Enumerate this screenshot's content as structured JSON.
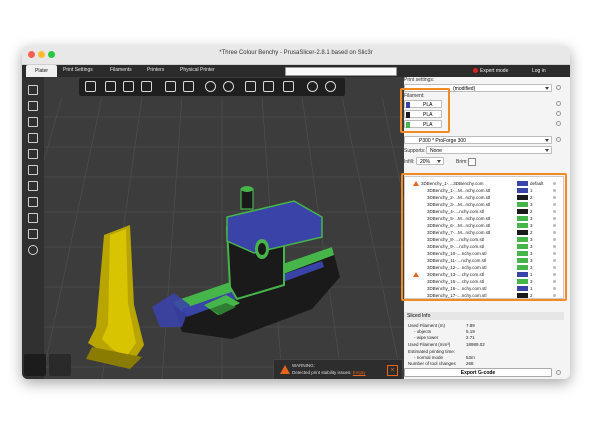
{
  "window": {
    "title": "*Three Colour Benchy - PrusaSlicer-2.8.1 based on Slic3r"
  },
  "tabs": [
    {
      "label": "Plater"
    },
    {
      "label": "Print Settings"
    },
    {
      "label": "Filaments"
    },
    {
      "label": "Printers"
    },
    {
      "label": "Physical Printer"
    }
  ],
  "header": {
    "expert_mode": "Expert mode",
    "login": "Log in"
  },
  "settings": {
    "print_settings_label": "Print settings:",
    "print_profile": "(modified)",
    "filament_label": "Filament:",
    "filaments": [
      {
        "name": "PLA",
        "color": "#3a43a8"
      },
      {
        "name": "PLA",
        "color": "#1a1a1a"
      },
      {
        "name": "PLA",
        "color": "#46b54a"
      }
    ],
    "printer": "P300 * ProForge 300",
    "supports_label": "Supports:",
    "supports_value": "None",
    "infill_label": "Infill:",
    "infill_value": "20%",
    "brim_label": "Brim:"
  },
  "objects": {
    "rows": [
      {
        "name": "3DBenchy_1-....3DBenchy.com",
        "extruder": "default",
        "color": "#3a43a8",
        "warn": true
      },
      {
        "name": "3DBenchy_1-...M...nchy.com.stl",
        "extruder": "1",
        "color": "#3a43a8",
        "warn": false
      },
      {
        "name": "3DBenchy_2-...M...nchy.com.stl",
        "extruder": "2",
        "color": "#1a1a1a",
        "warn": false
      },
      {
        "name": "3DBenchy_3-...M...nchy.com.stl",
        "extruder": "3",
        "color": "#46b54a",
        "warn": false
      },
      {
        "name": "3DBenchy_4-....nchy.com.stl",
        "extruder": "2",
        "color": "#1a1a1a",
        "warn": false
      },
      {
        "name": "3DBenchy_5-...M...nchy.com.stl",
        "extruder": "3",
        "color": "#46b54a",
        "warn": false
      },
      {
        "name": "3DBenchy_6-...M...nchy.com.stl",
        "extruder": "3",
        "color": "#46b54a",
        "warn": false
      },
      {
        "name": "3DBenchy_7-...M...nchy.com.stl",
        "extruder": "2",
        "color": "#1a1a1a",
        "warn": false
      },
      {
        "name": "3DBenchy_8-....nchy.com.stl",
        "extruder": "3",
        "color": "#46b54a",
        "warn": false
      },
      {
        "name": "3DBenchy_9-....nchy.com.stl",
        "extruder": "3",
        "color": "#46b54a",
        "warn": false
      },
      {
        "name": "3DBenchy_10-....nchy.com.stl",
        "extruder": "3",
        "color": "#46b54a",
        "warn": false
      },
      {
        "name": "3DBenchy_11-....nchy.com.stl",
        "extruder": "3",
        "color": "#46b54a",
        "warn": false
      },
      {
        "name": "3DBenchy_12-....nchy.com.stl",
        "extruder": "3",
        "color": "#46b54a",
        "warn": false
      },
      {
        "name": "3DBenchy_13-....chy.com.stl",
        "extruder": "1",
        "color": "#3a43a8",
        "warn": true
      },
      {
        "name": "3DBenchy_15-....chy.com.stl",
        "extruder": "3",
        "color": "#46b54a",
        "warn": false
      },
      {
        "name": "3DBenchy_16-....nchy.com.stl",
        "extruder": "1",
        "color": "#3a43a8",
        "warn": false
      },
      {
        "name": "3DBenchy_17-....nchy.com.stl",
        "extruder": "2",
        "color": "#1a1a1a",
        "warn": false
      }
    ]
  },
  "sliced_info": {
    "title": "Sliced Info",
    "rows": [
      {
        "label": "Used Filament (m)",
        "value": "7.89"
      },
      {
        "label": "- objects",
        "value": "5.19"
      },
      {
        "label": "- wipe tower",
        "value": "2.71"
      },
      {
        "label": "Used Filament (mm³)",
        "value": "18989.02"
      },
      {
        "label": "Estimated printing time:",
        "value": ""
      },
      {
        "label": "- normal mode",
        "value": "53m"
      },
      {
        "label": "Number of tool changes",
        "value": "268"
      }
    ]
  },
  "export_label": "Export G-code",
  "warning": {
    "title": "WARNING:",
    "text": "Detected print stability issues:",
    "link": "Empty"
  },
  "view_buttons": {
    "settings_label": "Settings"
  },
  "colors": {
    "accent": "#f08a25",
    "blue": "#3a43a8",
    "green": "#46b54a",
    "tower": "#c8b400"
  }
}
